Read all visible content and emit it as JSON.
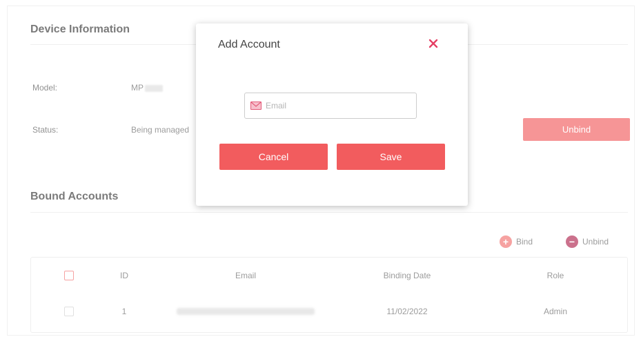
{
  "device_info": {
    "title": "Device Information",
    "model_label": "Model:",
    "model_value": "MP",
    "status_label": "Status:",
    "status_value": "Being managed",
    "unbind_button": "Unbind"
  },
  "bound_accounts": {
    "title": "Bound Accounts",
    "add_label": "Bind",
    "unbind_label": "Unbind",
    "columns": [
      "ID",
      "Email",
      "Binding Date",
      "Role"
    ],
    "rows": [
      {
        "id": "1",
        "email": "",
        "binding_date": "11/02/2022",
        "role": "Admin"
      }
    ]
  },
  "modal": {
    "title": "Add Account",
    "email_placeholder": "Email",
    "cancel_label": "Cancel",
    "save_label": "Save"
  },
  "colors": {
    "accent": "#f25c5e",
    "close": "#e53f64",
    "unbind_icon": "#b0254f"
  },
  "icons": {
    "close": "close-icon",
    "mail": "mail-icon",
    "add": "add-circle-icon",
    "remove": "remove-circle-icon"
  }
}
